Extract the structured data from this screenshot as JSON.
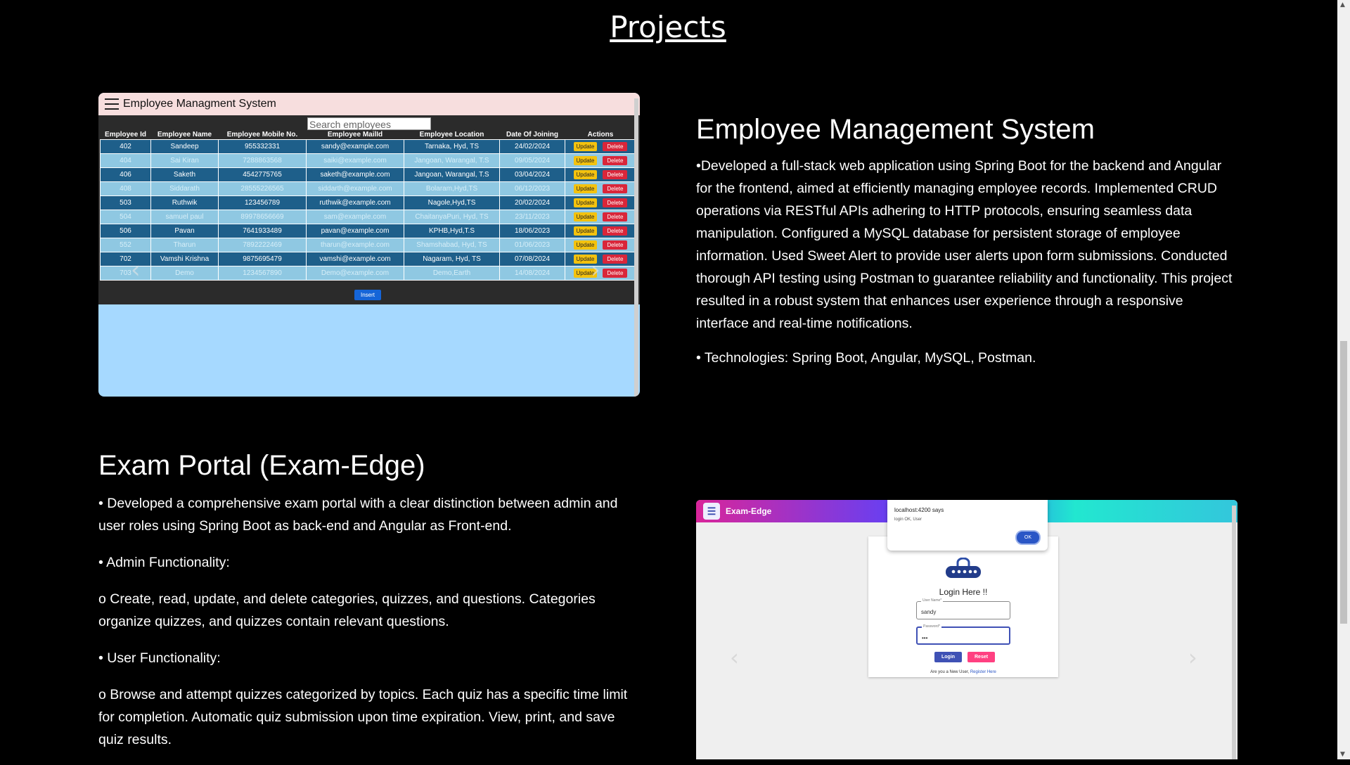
{
  "section_title": "Projects",
  "project1": {
    "title": "Employee Management System",
    "description": "•Developed a full-stack web application using Spring Boot for the backend and Angular for the frontend, aimed at efficiently managing employee records. Implemented CRUD operations via RESTful APIs adhering to HTTP protocols, ensuring seamless data manipulation. Configured a MySQL database for persistent storage of employee information. Used Sweet Alert to provide user alerts upon form submissions. Conducted thorough API testing using Postman to guarantee reliability and functionality. This project resulted in a robust system that enhances user experience through a responsive interface and real-time notifications.",
    "technologies": "• Technologies: Spring Boot, Angular, MySQL, Postman.",
    "screenshot": {
      "app_title": "Employee Managment System",
      "search_placeholder": "Search employees",
      "columns": [
        "Employee Id",
        "Employee Name",
        "Employee Mobile No.",
        "Employee MailId",
        "Employee Location",
        "Date Of Joining",
        "Actions"
      ],
      "rows": [
        [
          "402",
          "Sandeep",
          "955332331",
          "sandy@example.com",
          "Tarnaka, Hyd, TS",
          "24/02/2024"
        ],
        [
          "404",
          "Sai Kiran",
          "7288863568",
          "saiki@example.com",
          "Jangoan, Warangal, T.S",
          "09/05/2024"
        ],
        [
          "406",
          "Saketh",
          "4542775765",
          "saketh@example.com",
          "Jangoan, Warangal, T.S",
          "03/04/2024"
        ],
        [
          "408",
          "Siddarath",
          "28555226565",
          "siddarth@example.com",
          "Bolaram,Hyd,TS",
          "06/12/2023"
        ],
        [
          "503",
          "Ruthwik",
          "123456789",
          "ruthwik@example.com",
          "Nagole,Hyd,TS",
          "20/02/2024"
        ],
        [
          "504",
          "samuel paul",
          "89978656669",
          "sam@example.com",
          "ChaitanyaPuri, Hyd, TS",
          "23/11/2023"
        ],
        [
          "506",
          "Pavan",
          "7641933489",
          "pavan@example.com",
          "KPHB,Hyd,T.S",
          "18/06/2023"
        ],
        [
          "552",
          "Tharun",
          "7892222469",
          "tharun@example.com",
          "Shamshabad, Hyd, TS",
          "01/06/2023"
        ],
        [
          "702",
          "Vamshi Krishna",
          "9875695479",
          "vamshi@example.com",
          "Nagaram, Hyd, TS",
          "07/08/2024"
        ],
        [
          "703",
          "Demo",
          "1234567890",
          "Demo@example.com",
          "Demo,Earth",
          "14/08/2024"
        ]
      ],
      "update_label": "Update",
      "delete_label": "Delete",
      "insert_label": "Insert"
    }
  },
  "project2": {
    "title": "Exam Portal (Exam-Edge)",
    "paragraphs": [
      "• Developed a comprehensive exam portal with a clear distinction between admin and user roles using Spring Boot as back-end and Angular as Front-end.",
      "• Admin Functionality:",
      "o Create, read, update, and delete categories, quizzes, and questions. Categories organize quizzes, and quizzes contain relevant questions.",
      "• User Functionality:",
      "o Browse and attempt quizzes categorized by topics. Each quiz has a specific time limit for completion. Automatic quiz submission upon time expiration. View, print, and save quiz results."
    ],
    "screenshot": {
      "app_name": "Exam-Edge",
      "alert_title": "localhost:4200 says",
      "alert_message": "login OK, User",
      "alert_ok": "OK",
      "login_title": "Login Here !!",
      "username_label": "User Name*",
      "username_value": "sandy",
      "password_label": "Password*",
      "password_value": "•••",
      "login_button": "Login",
      "reset_button": "Reset",
      "register_prompt": "Are you a New User,",
      "register_link": "Register Here"
    }
  },
  "colors": {
    "background": "#000000",
    "text": "#ffffff",
    "table_dark": "#1e5f8a",
    "table_light": "#8fc8e2",
    "update": "#f3c20e",
    "delete": "#d9263a"
  },
  "icons": [
    "menu-icon",
    "chevron-left-icon",
    "chevron-right-icon",
    "exam-logo-icon",
    "lock-icon"
  ]
}
